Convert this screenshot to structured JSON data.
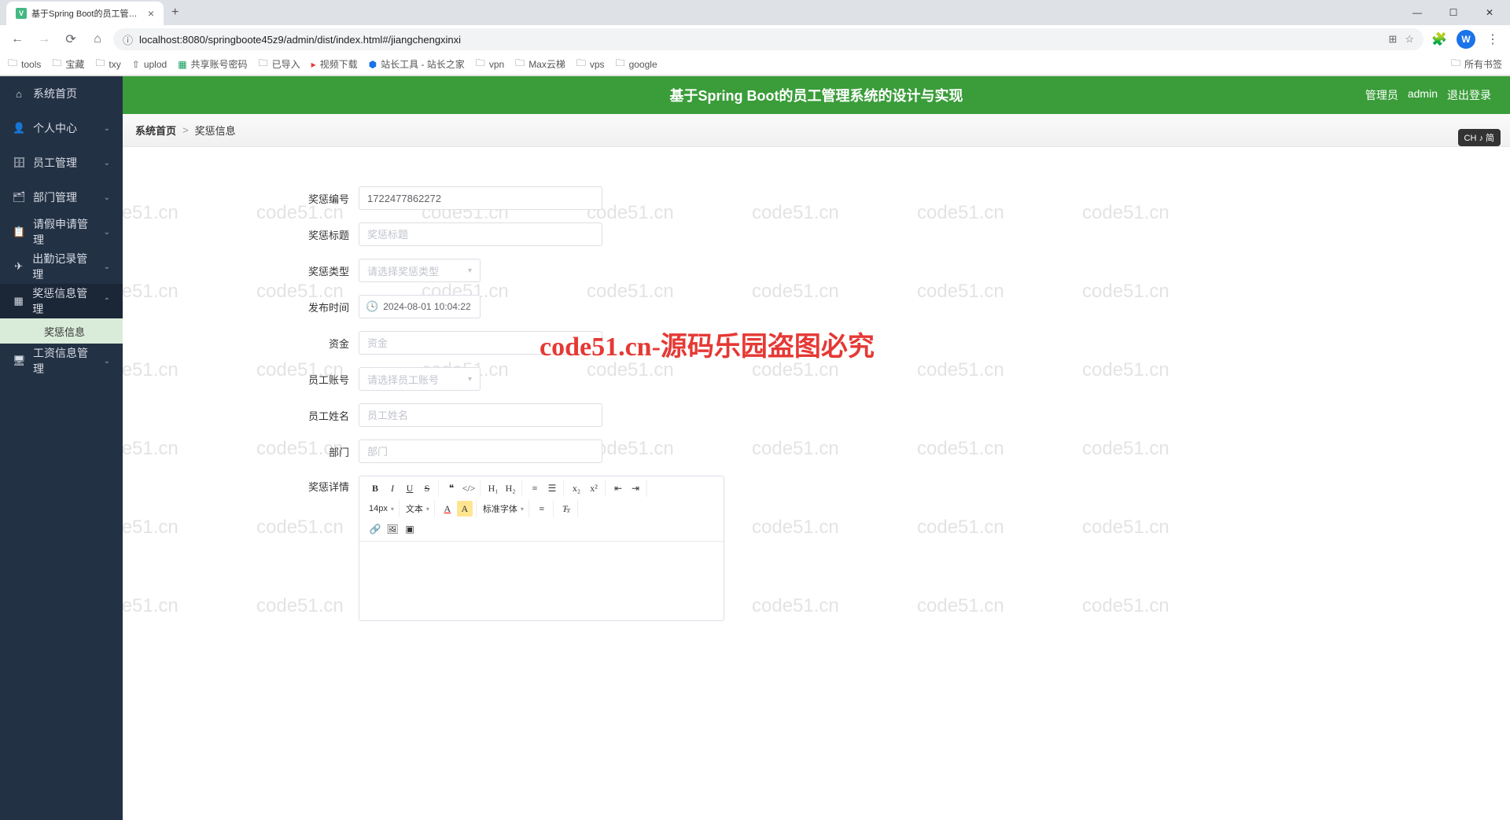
{
  "browser": {
    "tab_title": "基于Spring Boot的员工管理系",
    "url": "localhost:8080/springboote45z9/admin/dist/index.html#/jiangchengxinxi",
    "bookmarks": [
      "tools",
      "宝藏",
      "txy",
      "uplod",
      "共享账号密码",
      "已导入",
      "视频下载",
      "站长工具 - 站长之家",
      "vpn",
      "Max云梯",
      "vps",
      "google"
    ],
    "bookmarks_right": "所有书签"
  },
  "banner": {
    "title": "基于Spring Boot的员工管理系统的设计与实现",
    "role": "管理员",
    "user": "admin",
    "logout": "退出登录"
  },
  "breadcrumb": {
    "home": "系统首页",
    "sep": ">",
    "current": "奖惩信息"
  },
  "sidebar": {
    "items": [
      {
        "label": "系统首页",
        "icon": "⌂"
      },
      {
        "label": "个人中心",
        "icon": "👤",
        "chevron": true
      },
      {
        "label": "员工管理",
        "icon": "🗄",
        "chevron": true
      },
      {
        "label": "部门管理",
        "icon": "🗂",
        "chevron": true
      },
      {
        "label": "请假申请管理",
        "icon": "📋",
        "chevron": true
      },
      {
        "label": "出勤记录管理",
        "icon": "✈",
        "chevron": true
      },
      {
        "label": "奖惩信息管理",
        "icon": "▦",
        "chevron": true,
        "open": true,
        "sub": "奖惩信息"
      },
      {
        "label": "工资信息管理",
        "icon": "🖥",
        "chevron": true
      }
    ]
  },
  "form": {
    "id_label": "奖惩编号",
    "id_value": "1722477862272",
    "title_label": "奖惩标题",
    "title_placeholder": "奖惩标题",
    "type_label": "奖惩类型",
    "type_placeholder": "请选择奖惩类型",
    "time_label": "发布时间",
    "time_value": "2024-08-01 10:04:22",
    "money_label": "资金",
    "money_placeholder": "资金",
    "account_label": "员工账号",
    "account_placeholder": "请选择员工账号",
    "name_label": "员工姓名",
    "name_placeholder": "员工姓名",
    "dept_label": "部门",
    "dept_placeholder": "部门",
    "detail_label": "奖惩详情"
  },
  "editor": {
    "font_size": "14px",
    "font_type": "文本",
    "font_family": "标准字体"
  },
  "watermark": {
    "text": "code51.cn",
    "center": "code51.cn-源码乐园盗图必究"
  },
  "ime": "CH ♪ 简"
}
